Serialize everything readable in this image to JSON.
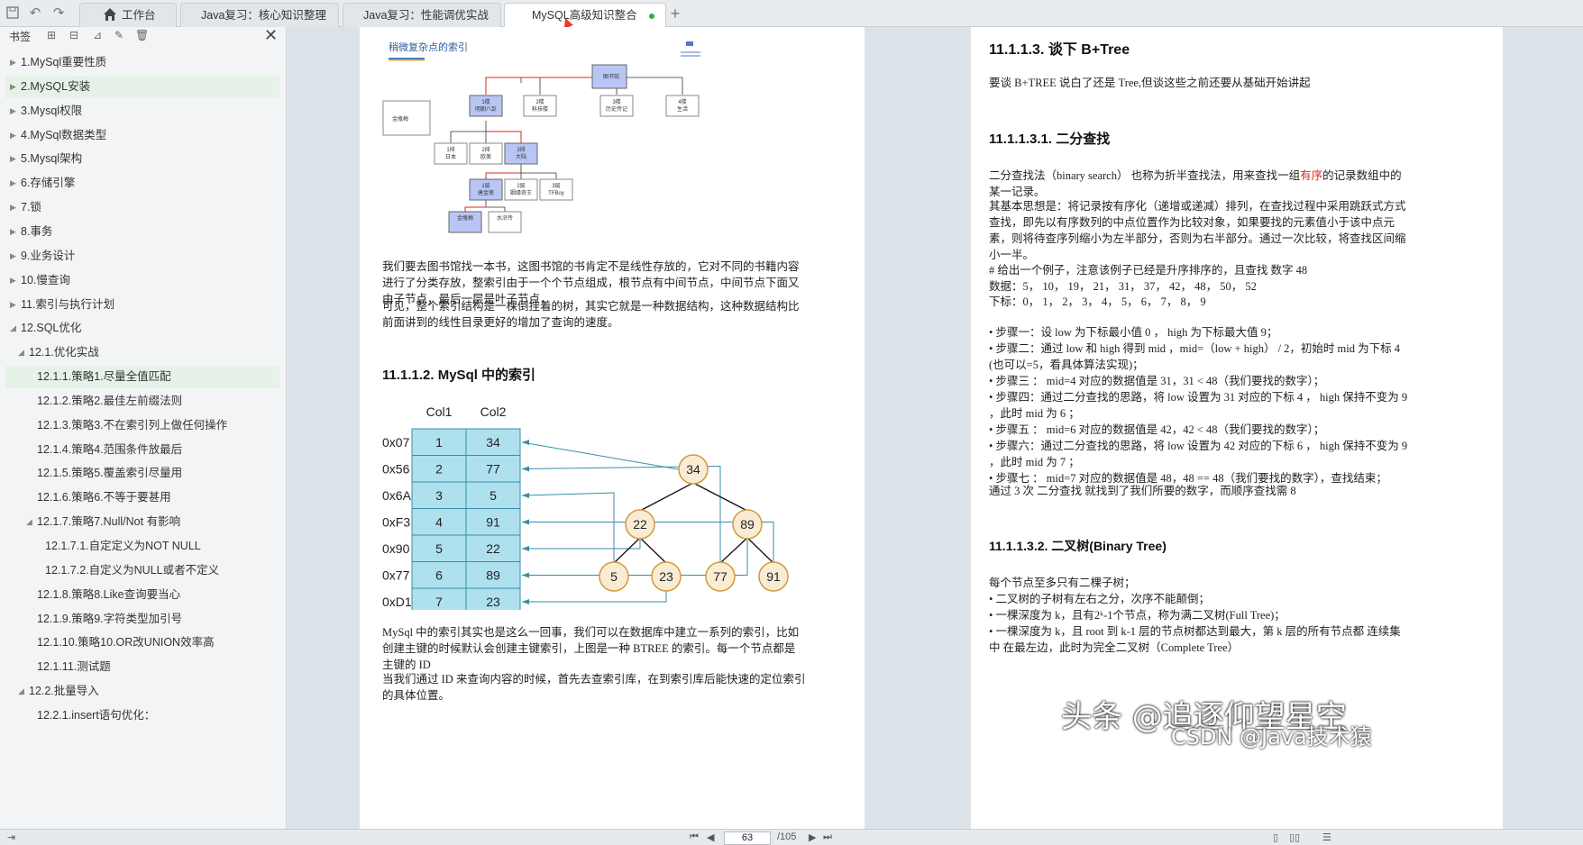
{
  "tabs": [
    {
      "label": "工作台"
    },
    {
      "label": "Java复习：核心知识整理"
    },
    {
      "label": "Java复习：性能调优实战"
    },
    {
      "label": "MySQL高级知识整合"
    }
  ],
  "sidebar": {
    "title": "书签",
    "items": [
      {
        "label": "1.MySql重要性质"
      },
      {
        "label": "2.MySQL安装"
      },
      {
        "label": "3.Mysql权限"
      },
      {
        "label": "4.MySql数据类型"
      },
      {
        "label": "5.Mysql架构"
      },
      {
        "label": "6.存储引擎"
      },
      {
        "label": "7.锁"
      },
      {
        "label": "8.事务"
      },
      {
        "label": "9.业务设计"
      },
      {
        "label": "10.慢查询"
      },
      {
        "label": "11.索引与执行计划"
      },
      {
        "label": "12.SQL优化"
      },
      {
        "label": "12.1.优化实战"
      },
      {
        "label": "12.1.1.策略1.尽量全值匹配"
      },
      {
        "label": "12.1.2.策略2.最佳左前缀法则"
      },
      {
        "label": "12.1.3.策略3.不在索引列上做任何操作"
      },
      {
        "label": "12.1.4.策略4.范围条件放最后"
      },
      {
        "label": "12.1.5.策略5.覆盖索引尽量用"
      },
      {
        "label": "12.1.6.策略6.不等于要甚用"
      },
      {
        "label": "12.1.7.策略7.Null/Not 有影响"
      },
      {
        "label": "12.1.7.1.自定定义为NOT NULL"
      },
      {
        "label": "12.1.7.2.自定义为NULL或者不定义"
      },
      {
        "label": "12.1.8.策略8.Like查询要当心"
      },
      {
        "label": "12.1.9.策略9.字符类型加引号"
      },
      {
        "label": "12.1.10.策略10.OR改UNION效率高"
      },
      {
        "label": "12.1.11.测试题"
      },
      {
        "label": "12.2.批量导入"
      },
      {
        "label": "12.2.1.insert语句优化："
      }
    ]
  },
  "left_page": {
    "fig1": {
      "title": "稍微复杂点的索引",
      "side_label": "金瓶梅",
      "root": "图书馆",
      "l1": [
        "1楼\n明朝八卦",
        "2楼\n科技楼",
        "3楼\n历史传记",
        "4楼\n生活"
      ],
      "l2": [
        "1排\n日本",
        "2排\n欧美",
        "3排\n大陆"
      ],
      "l3": [
        "1层\n唐金莲",
        "2层\n姻缘奇王",
        "3层\nTFBoy"
      ],
      "l4": [
        "金瓶梅",
        "水浒传"
      ]
    },
    "para1": "我们要去图书馆找一本书，这图书馆的书肯定不是线性存放的，它对不同的书籍内容进行了分类存放，整索引由于一个个节点组成，根节点有中间节点，中间节点下面又由子节点，最后一层是叶子节点，",
    "para2": "可见，整个索引结构是一棵倒挂着的树，其实它就是一种数据结构，这种数据结构比前面讲到的线性目录更好的增加了查询的速度。",
    "heading": "11.1.1.2.  MySql 中的索引",
    "fig2": {
      "col1": "Col1",
      "col2": "Col2",
      "rows": [
        {
          "addr": "0x07",
          "c1": "1",
          "c2": "34"
        },
        {
          "addr": "0x56",
          "c1": "2",
          "c2": "77"
        },
        {
          "addr": "0x6A",
          "c1": "3",
          "c2": "5"
        },
        {
          "addr": "0xF3",
          "c1": "4",
          "c2": "91"
        },
        {
          "addr": "0x90",
          "c1": "5",
          "c2": "22"
        },
        {
          "addr": "0x77",
          "c1": "6",
          "c2": "89"
        },
        {
          "addr": "0xD1",
          "c1": "7",
          "c2": "23"
        }
      ],
      "nodes": [
        "34",
        "22",
        "89",
        "5",
        "23",
        "77",
        "91"
      ]
    },
    "para3": "MySql 中的索引其实也是这么一回事，我们可以在数据库中建立一系列的索引，比如创建主键的时候默认会创建主键索引，上图是一种 BTREE 的索引。每一个节点都是主键的 ID",
    "para4": "当我们通过 ID 来查询内容的时候，首先去查索引库，在到索引库后能快速的定位索引的具体位置。"
  },
  "right_page": {
    "h1": "11.1.1.3.  谈下 B+Tree",
    "p1": "要谈 B+TREE 说白了还是 Tree,但谈这些之前还要从基础开始讲起",
    "h2": "11.1.1.3.1. 二分查找",
    "p2a": "二分查找法（binary search） 也称为折半查找法，用来查找一组",
    "p2red": "有序",
    "p2b": "的记录数组中的某一记录。",
    "p3": "其基本思想是：将记录按有序化（递增或递减）排列，在查找过程中采用跳跃式方式查找，即先以有序数列的中点位置作为比较对象，如果要找的元素值小于该中点元素，则将待查序列缩小为左半部分，否则为右半部分。通过一次比较，将查找区间缩小一半。",
    "ex1": "# 给出一个例子，注意该例子已经是升序排序的，且查找 数字 48",
    "ex2": "数据：5，   10，  19，  21，  31，  37，  42，  48，  50，   52",
    "ex3": "下标：0，   1，    2，    3，    4，    5，    6，    7，    8，    9",
    "steps": [
      "• 步骤一：设 low 为下标最小值 0 ， high 为下标最大值 9；",
      "• 步骤二：通过 low 和 high 得到 mid ，mid=（low + high） / 2，初始时 mid 为下标 4 (也可以=5，看具体算法实现)；",
      "• 步骤三 ： mid=4 对应的数据值是 31，31 < 48（我们要找的数字）；",
      "• 步骤四：通过二分查找的思路，将 low 设置为 31 对应的下标 4 ， high 保持不变为 9 ，此时 mid 为 6 ；",
      "• 步骤五 ： mid=6 对应的数据值是 42，42 < 48（我们要找的数字）；",
      "• 步骤六：通过二分查找的思路，将 low 设置为 42 对应的下标 6 ， high 保持不变为 9 ，此时 mid 为 7 ；",
      "• 步骤七 ： mid=7 对应的数据值是 48，48 == 48（我们要找的数字），查找结束；"
    ],
    "p4": "通过 3 次 二分查找 就找到了我们所要的数字，而顺序查找需 8",
    "h3": "11.1.1.3.2. 二叉树(Binary Tree)",
    "p5": "每个节点至多只有二棵子树；",
    "bullets": [
      "• 二叉树的子树有左右之分，次序不能颠倒；",
      "• 一棵深度为 k，且有2ᵏ-1个节点，称为满二叉树(Full Tree)；",
      "• 一棵深度为 k，且 root 到 k-1 层的节点树都达到最大，第 k 层的所有节点都 连续集中 在最左边，此时为完全二叉树（Complete Tree）"
    ]
  },
  "status": {
    "page": "63",
    "total": "/105"
  },
  "watermark": {
    "main": "头条 @追逐仰望星空",
    "sub": "CSDN @Java技术猿"
  }
}
